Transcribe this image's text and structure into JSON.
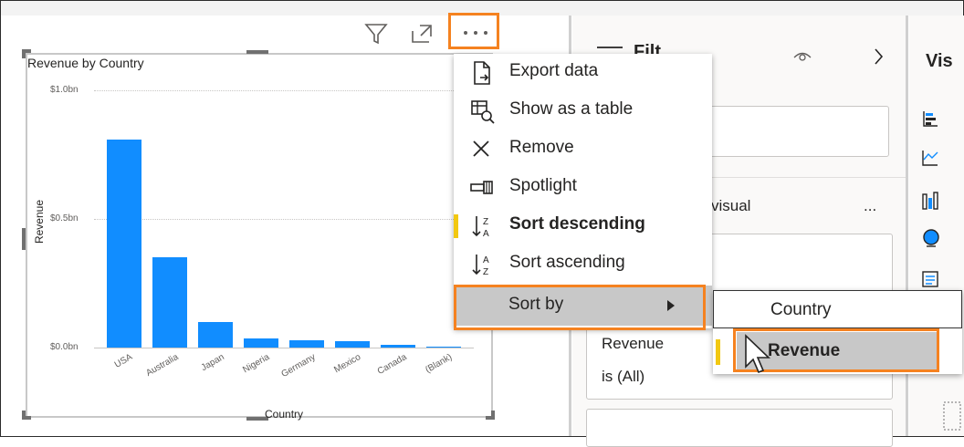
{
  "chart": {
    "title": "Revenue by Country",
    "ylabel": "Revenue",
    "xlabel": "Country",
    "yticks": [
      "$1.0bn",
      "$0.5bn",
      "$0.0bn"
    ]
  },
  "chart_data": {
    "type": "bar",
    "title": "Revenue by Country",
    "xlabel": "Country",
    "ylabel": "Revenue",
    "categories": [
      "USA",
      "Australia",
      "Japan",
      "Nigeria",
      "Germany",
      "Mexico",
      "Canada",
      "(Blank)"
    ],
    "values": [
      0.81,
      0.35,
      0.1,
      0.035,
      0.03,
      0.025,
      0.01,
      0.005
    ],
    "unit": "$bn",
    "ylim": [
      0,
      1.0
    ],
    "grid": true,
    "colors": {
      "bar": "#118dff"
    }
  },
  "menu": {
    "items": [
      {
        "label": "Export data",
        "icon": "export-icon"
      },
      {
        "label": "Show as a table",
        "icon": "table-icon"
      },
      {
        "label": "Remove",
        "icon": "close-icon"
      },
      {
        "label": "Spotlight",
        "icon": "spotlight-icon"
      },
      {
        "label": "Sort descending",
        "icon": "sort-descending-icon"
      },
      {
        "label": "Sort ascending",
        "icon": "sort-ascending-icon"
      },
      {
        "label": "Sort by",
        "icon": "chevron-right-icon"
      }
    ]
  },
  "submenu": {
    "items": [
      {
        "label": "Country"
      },
      {
        "label": "Revenue"
      }
    ]
  },
  "filters": {
    "title_partial": "Filt",
    "visual_label_partial": "visual",
    "more": "...",
    "filter_card_line1": "Revenue",
    "filter_card_line2": "is (All)"
  },
  "viz_pane": {
    "title_partial": "Vis"
  },
  "colors": {
    "accent_orange": "#f58220",
    "selected_gray": "#c8c8c8",
    "sort_indicator": "#f2c811"
  }
}
